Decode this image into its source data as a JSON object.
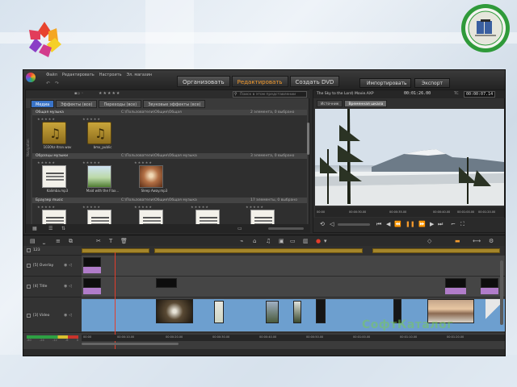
{
  "topbar": {
    "menu": [
      "Файл",
      "Редактировать",
      "Настроить",
      "Эл. магазин"
    ],
    "mode_tabs": [
      "Организовать",
      "Редактировать",
      "Создать DVD"
    ],
    "active_tab_index": 1,
    "import_label": "Импортировать",
    "export_label": "Экспорт"
  },
  "library": {
    "search_placeholder": "Поиск в этом представлении",
    "tabs": [
      "Медиа",
      "Эффекты (все)",
      "Переходы (все)",
      "Звуковые эффекты (все)"
    ],
    "active_tab_index": 0,
    "side_label": "Navigation",
    "sections": [
      {
        "title": "Общая музыка",
        "path": "C:\\Пользователи\\Общие\\Общая",
        "count": "2 элемента, 0 выбрано",
        "items": [
          {
            "caption": "1030hz-ltron.wav",
            "kind": "music"
          },
          {
            "caption": "bmx_public",
            "kind": "music"
          }
        ]
      },
      {
        "title": "Образцы музыки",
        "path": "C:\\Пользователи\\Общие\\Общая музыка",
        "count": "3 элемента, 0 выбрано",
        "items": [
          {
            "caption": "Kalimba.mp3",
            "kind": "doc"
          },
          {
            "caption": "Maid with the Flax...",
            "kind": "land"
          },
          {
            "caption": "Sleep Away.mp3",
            "kind": "sun"
          }
        ]
      },
      {
        "title": "Браузер music",
        "path": "C:\\Пользователи\\Общие\\Общая музыка",
        "count": "17 элементы, 0 выбрано",
        "items": []
      }
    ]
  },
  "player": {
    "title": "The Sky to the Lord) Movie.AXP",
    "timecode": "00:01:26.00",
    "tc_label": "TC",
    "timecode_right": "00:00:07.14",
    "tabs": [
      "Источник",
      "Временная шкала"
    ],
    "active_tab_index": 1,
    "ruler_ticks": [
      "00:00",
      "00:00:30.00",
      "00:00:35.00",
      "00:00:40.00",
      "00:01:00.00",
      "00:01:20.00"
    ]
  },
  "timeline": {
    "tracks": [
      {
        "label": "[5] Overlay"
      },
      {
        "label": "[4] Title"
      },
      {
        "label": "[3] Video"
      }
    ],
    "ruler_ticks": [
      "00:00",
      "00:00:10.00",
      "00:00:20.00",
      "00:00:30.00",
      "00:00:40.00",
      "00:00:50.00",
      "00:01:00.00",
      "00:01:10.00",
      "00:01:20.00"
    ],
    "meter_scale": [
      "-60",
      "-24",
      "-12",
      "-6",
      "0"
    ]
  },
  "watermark": "СофтКаталог",
  "colors": {
    "accent": "#f29a2e",
    "tab_blue": "#3a74c8",
    "clip_blue": "#6d9fcf",
    "clip_purple": "#b07cc9",
    "playhead": "#e23d2a"
  }
}
